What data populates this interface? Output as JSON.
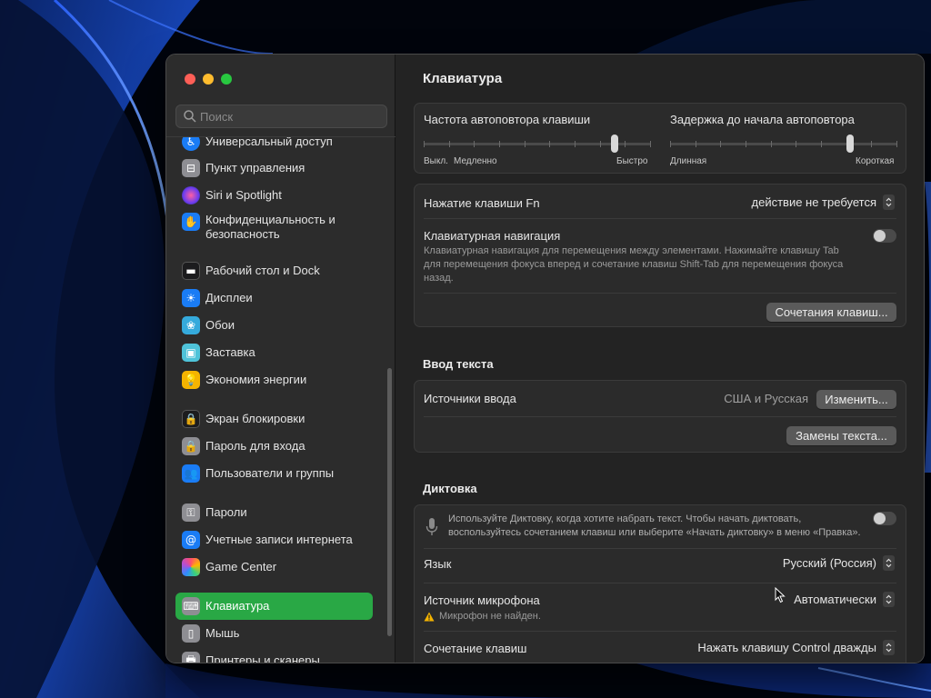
{
  "sidebar": {
    "search_placeholder": "Поиск",
    "items": [
      {
        "label": "Универсальный доступ",
        "icon": "accessibility-icon",
        "color": "#1a7cf5"
      },
      {
        "label": "Пункт управления",
        "icon": "control-center-icon",
        "color": "#8e8e93"
      },
      {
        "label": "Siri и Spotlight",
        "icon": "siri-icon",
        "color": "#b14fd8"
      },
      {
        "label": "Конфиденциальность и безопасность",
        "icon": "privacy-hand-icon",
        "color": "#1a7cf5"
      },
      {
        "label": "Рабочий стол и Dock",
        "icon": "desktop-dock-icon",
        "color": "#1c1c1e"
      },
      {
        "label": "Дисплеи",
        "icon": "displays-icon",
        "color": "#1a7cf5"
      },
      {
        "label": "Обои",
        "icon": "wallpaper-icon",
        "color": "#35aadc"
      },
      {
        "label": "Заставка",
        "icon": "screensaver-icon",
        "color": "#4fc3d9"
      },
      {
        "label": "Экономия энергии",
        "icon": "energy-bulb-icon",
        "color": "#f5b400"
      },
      {
        "label": "Экран блокировки",
        "icon": "lock-screen-icon",
        "color": "#1c1c1e"
      },
      {
        "label": "Пароль для входа",
        "icon": "login-password-icon",
        "color": "#8e8e93"
      },
      {
        "label": "Пользователи и группы",
        "icon": "users-groups-icon",
        "color": "#1a7cf5"
      },
      {
        "label": "Пароли",
        "icon": "passwords-key-icon",
        "color": "#8e8e93"
      },
      {
        "label": "Учетные записи интернета",
        "icon": "internet-accounts-icon",
        "color": "#1a7cf5"
      },
      {
        "label": "Game Center",
        "icon": "game-center-icon",
        "color": "#ffffff"
      },
      {
        "label": "Клавиатура",
        "icon": "keyboard-icon",
        "color": "#8e8e93"
      },
      {
        "label": "Мышь",
        "icon": "mouse-icon",
        "color": "#8e8e93"
      },
      {
        "label": "Принтеры и сканеры",
        "icon": "printer-icon",
        "color": "#8e8e93"
      }
    ],
    "active_label": "Клавиатура",
    "active_color": "#29a845"
  },
  "main": {
    "title": "Клавиатура",
    "repeat": {
      "rate_label": "Частота автоповтора клавиши",
      "rate_caps": [
        "Выкл.",
        "Медленно",
        "Быстро"
      ],
      "rate_level": 0.85,
      "delay_label": "Задержка до начала автоповтора",
      "delay_caps": [
        "Длинная",
        "Короткая"
      ],
      "delay_level": 0.8
    },
    "fn": {
      "label": "Нажатие клавиши Fn",
      "value": "действие не требуется"
    },
    "nav": {
      "label": "Клавиатурная навигация",
      "description": "Клавиатурная навигация для перемещения между элементами. Нажимайте клавишу Tab для перемещения фокуса вперед и сочетание клавиш Shift-Tab для перемещения фокуса назад.",
      "enabled": false
    },
    "shortcuts_button": "Сочетания клавиш...",
    "text_input": {
      "section": "Ввод текста",
      "sources_label": "Источники ввода",
      "sources_value": "США и Русская",
      "edit_button": "Изменить...",
      "replacements_button": "Замены текста..."
    },
    "dictation": {
      "section": "Диктовка",
      "description": "Используйте Диктовку, когда хотите набрать текст. Чтобы начать диктовать, воспользуйтесь сочетанием клавиш или выберите «Начать диктовку» в меню «Правка».",
      "enabled": false,
      "language_label": "Язык",
      "language_value": "Русский (Россия)",
      "mic_label": "Источник микрофона",
      "mic_value": "Автоматически",
      "mic_warning": "Микрофон не найден.",
      "shortcut_label": "Сочетание клавиш",
      "shortcut_value": "Нажать клавишу Control дважды"
    }
  }
}
